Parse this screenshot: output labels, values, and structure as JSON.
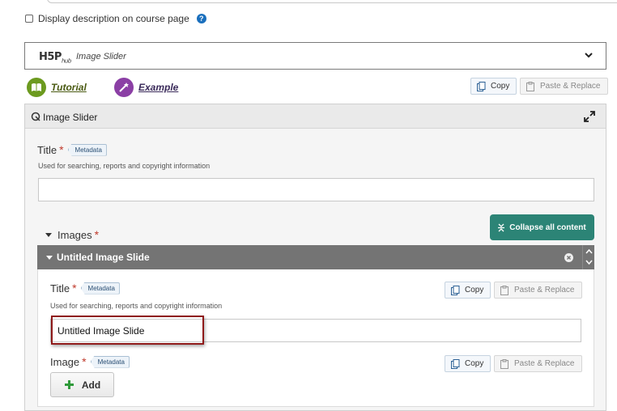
{
  "display_description": {
    "label": "Display description on course page",
    "help": "?"
  },
  "hub": {
    "logo_main": "H5P",
    "logo_sub": "hub",
    "selected": "Image Slider"
  },
  "links": {
    "tutorial": "Tutorial",
    "example": "Example"
  },
  "actions": {
    "copy": "Copy",
    "paste": "Paste & Replace"
  },
  "editor": {
    "title": "Image Slider",
    "title_field": {
      "label": "Title",
      "required": "*",
      "metadata": "Metadata",
      "description": "Used for searching, reports and copyright information",
      "value": ""
    },
    "images": {
      "label": "Images",
      "required": "*",
      "collapse_all": "Collapse all content",
      "slide": {
        "title": "Untitled Image Slide",
        "title_field": {
          "label": "Title",
          "required": "*",
          "metadata": "Metadata",
          "description": "Used for searching, reports and copyright information",
          "value": "Untitled Image Slide"
        },
        "image_field": {
          "label": "Image",
          "required": "*",
          "metadata": "Metadata",
          "add": "Add"
        }
      }
    }
  },
  "colors": {
    "accent": "#2c8476",
    "slide_bar": "#747474",
    "highlight": "#8f1a1a",
    "required": "#c0392b"
  }
}
